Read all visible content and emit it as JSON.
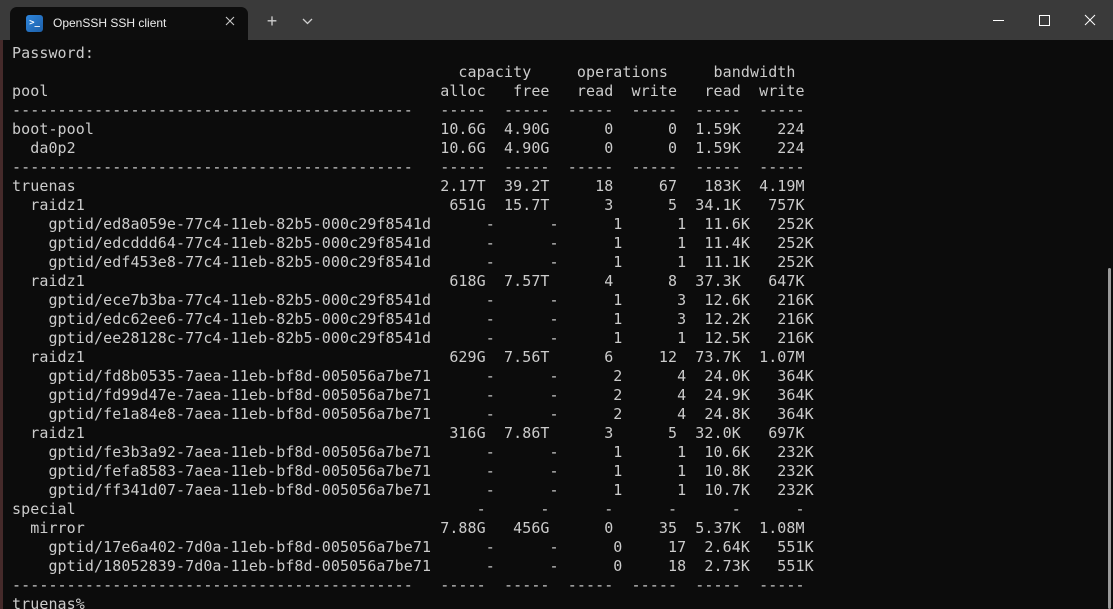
{
  "window": {
    "tab_title": "OpenSSH SSH client",
    "tab_icon": ">_",
    "new_tab_label": "+"
  },
  "colors": {
    "titlebar_bg": "#3a3a3a",
    "tab_bg": "#0d0d0d",
    "terminal_bg": "#0c0c0c",
    "text_color": "#cccccc",
    "icon_blue": "#2671be",
    "edge_border": "#452a2a",
    "scrollbar_color": "#9a9a9a"
  },
  "terminal": {
    "password_prompt": "Password:",
    "shell_prompt": "truenas%",
    "table": {
      "group_headers": [
        "capacity",
        "operations",
        "bandwidth"
      ],
      "name_header": "pool",
      "stat_headers": [
        "alloc",
        "free",
        "read",
        "write",
        "read",
        "write"
      ],
      "rows": [
        {
          "type": "sep"
        },
        {
          "type": "data",
          "indent": 0,
          "name": "boot-pool",
          "cells": [
            "10.6G",
            "4.90G",
            "0",
            "0",
            "1.59K",
            "224"
          ]
        },
        {
          "type": "data",
          "indent": 2,
          "name": "da0p2",
          "cells": [
            "10.6G",
            "4.90G",
            "0",
            "0",
            "1.59K",
            "224"
          ]
        },
        {
          "type": "sep"
        },
        {
          "type": "data",
          "indent": 0,
          "name": "truenas",
          "cells": [
            "2.17T",
            "39.2T",
            "18",
            "67",
            "183K",
            "4.19M"
          ]
        },
        {
          "type": "data",
          "indent": 2,
          "name": "raidz1",
          "cells": [
            "651G",
            "15.7T",
            "3",
            "5",
            "34.1K",
            "757K"
          ]
        },
        {
          "type": "data",
          "indent": 4,
          "name": "gptid/ed8a059e-77c4-11eb-82b5-000c29f8541d",
          "cells": [
            "-",
            "-",
            "1",
            "1",
            "11.6K",
            "252K"
          ]
        },
        {
          "type": "data",
          "indent": 4,
          "name": "gptid/edcddd64-77c4-11eb-82b5-000c29f8541d",
          "cells": [
            "-",
            "-",
            "1",
            "1",
            "11.4K",
            "252K"
          ]
        },
        {
          "type": "data",
          "indent": 4,
          "name": "gptid/edf453e8-77c4-11eb-82b5-000c29f8541d",
          "cells": [
            "-",
            "-",
            "1",
            "1",
            "11.1K",
            "252K"
          ]
        },
        {
          "type": "data",
          "indent": 2,
          "name": "raidz1",
          "cells": [
            "618G",
            "7.57T",
            "4",
            "8",
            "37.3K",
            "647K"
          ]
        },
        {
          "type": "data",
          "indent": 4,
          "name": "gptid/ece7b3ba-77c4-11eb-82b5-000c29f8541d",
          "cells": [
            "-",
            "-",
            "1",
            "3",
            "12.6K",
            "216K"
          ]
        },
        {
          "type": "data",
          "indent": 4,
          "name": "gptid/edc62ee6-77c4-11eb-82b5-000c29f8541d",
          "cells": [
            "-",
            "-",
            "1",
            "3",
            "12.2K",
            "216K"
          ]
        },
        {
          "type": "data",
          "indent": 4,
          "name": "gptid/ee28128c-77c4-11eb-82b5-000c29f8541d",
          "cells": [
            "-",
            "-",
            "1",
            "1",
            "12.5K",
            "216K"
          ]
        },
        {
          "type": "data",
          "indent": 2,
          "name": "raidz1",
          "cells": [
            "629G",
            "7.56T",
            "6",
            "12",
            "73.7K",
            "1.07M"
          ]
        },
        {
          "type": "data",
          "indent": 4,
          "name": "gptid/fd8b0535-7aea-11eb-bf8d-005056a7be71",
          "cells": [
            "-",
            "-",
            "2",
            "4",
            "24.0K",
            "364K"
          ]
        },
        {
          "type": "data",
          "indent": 4,
          "name": "gptid/fd99d47e-7aea-11eb-bf8d-005056a7be71",
          "cells": [
            "-",
            "-",
            "2",
            "4",
            "24.9K",
            "364K"
          ]
        },
        {
          "type": "data",
          "indent": 4,
          "name": "gptid/fe1a84e8-7aea-11eb-bf8d-005056a7be71",
          "cells": [
            "-",
            "-",
            "2",
            "4",
            "24.8K",
            "364K"
          ]
        },
        {
          "type": "data",
          "indent": 2,
          "name": "raidz1",
          "cells": [
            "316G",
            "7.86T",
            "3",
            "5",
            "32.0K",
            "697K"
          ]
        },
        {
          "type": "data",
          "indent": 4,
          "name": "gptid/fe3b3a92-7aea-11eb-bf8d-005056a7be71",
          "cells": [
            "-",
            "-",
            "1",
            "1",
            "10.6K",
            "232K"
          ]
        },
        {
          "type": "data",
          "indent": 4,
          "name": "gptid/fefa8583-7aea-11eb-bf8d-005056a7be71",
          "cells": [
            "-",
            "-",
            "1",
            "1",
            "10.8K",
            "232K"
          ]
        },
        {
          "type": "data",
          "indent": 4,
          "name": "gptid/ff341d07-7aea-11eb-bf8d-005056a7be71",
          "cells": [
            "-",
            "-",
            "1",
            "1",
            "10.7K",
            "232K"
          ]
        },
        {
          "type": "data",
          "indent": 0,
          "name": "special",
          "cells": [
            "-",
            "-",
            "-",
            "-",
            "-",
            "-"
          ]
        },
        {
          "type": "data",
          "indent": 2,
          "name": "mirror",
          "cells": [
            "7.88G",
            "456G",
            "0",
            "35",
            "5.37K",
            "1.08M"
          ]
        },
        {
          "type": "data",
          "indent": 4,
          "name": "gptid/17e6a402-7d0a-11eb-bf8d-005056a7be71",
          "cells": [
            "-",
            "-",
            "0",
            "17",
            "2.64K",
            "551K"
          ]
        },
        {
          "type": "data",
          "indent": 4,
          "name": "gptid/18052839-7d0a-11eb-bf8d-005056a7be71",
          "cells": [
            "-",
            "-",
            "0",
            "18",
            "2.73K",
            "551K"
          ]
        },
        {
          "type": "sep"
        }
      ]
    }
  }
}
